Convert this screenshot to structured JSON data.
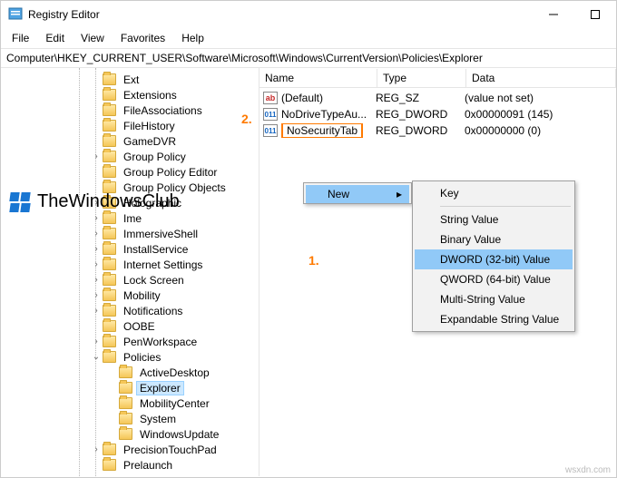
{
  "window": {
    "title": "Registry Editor",
    "menus": [
      "File",
      "Edit",
      "View",
      "Favorites",
      "Help"
    ],
    "address": "Computer\\HKEY_CURRENT_USER\\Software\\Microsoft\\Windows\\CurrentVersion\\Policies\\Explorer"
  },
  "tree": {
    "items": [
      "Ext",
      "Extensions",
      "FileAssociations",
      "FileHistory",
      "GameDVR",
      "Group Policy",
      "Group Policy Editor",
      "Group Policy Objects",
      "Holographic",
      "Ime",
      "ImmersiveShell",
      "InstallService",
      "Internet Settings",
      "Lock Screen",
      "Mobility",
      "Notifications",
      "OOBE",
      "PenWorkspace",
      "Policies"
    ],
    "policies_children": [
      "ActiveDesktop",
      "Explorer",
      "MobilityCenter",
      "System",
      "WindowsUpdate"
    ],
    "after": [
      "PrecisionTouchPad",
      "Prelaunch"
    ],
    "selected": "Explorer"
  },
  "list": {
    "columns": {
      "name": "Name",
      "type": "Type",
      "data": "Data"
    },
    "rows": [
      {
        "icon": "ab",
        "name": "(Default)",
        "type": "REG_SZ",
        "data": "(value not set)"
      },
      {
        "icon": "num",
        "name": "NoDriveTypeAu...",
        "type": "REG_DWORD",
        "data": "0x00000091 (145)"
      },
      {
        "icon": "num",
        "name": "NoSecurityTab",
        "type": "REG_DWORD",
        "data": "0x00000000 (0)",
        "editing": true
      }
    ]
  },
  "contextmenu": {
    "parent_item": "New",
    "items": [
      {
        "label": "Key",
        "sep_after": true
      },
      {
        "label": "String Value"
      },
      {
        "label": "Binary Value"
      },
      {
        "label": "DWORD (32-bit) Value",
        "highlight": true
      },
      {
        "label": "QWORD (64-bit) Value"
      },
      {
        "label": "Multi-String Value"
      },
      {
        "label": "Expandable String Value"
      }
    ]
  },
  "annotations": {
    "step1": "1.",
    "step2": "2."
  },
  "watermark": "TheWindowsClub",
  "credit": "wsxdn.com"
}
